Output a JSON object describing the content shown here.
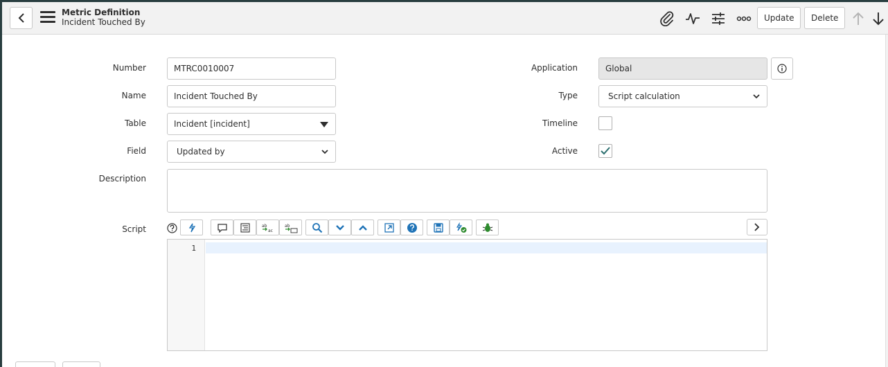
{
  "header": {
    "title": "Metric Definition",
    "subtitle": "Incident Touched By",
    "buttons": {
      "update": "Update",
      "delete": "Delete"
    },
    "icons": [
      "chevron-left-icon",
      "menu-icon",
      "paperclip-icon",
      "activity-icon",
      "sliders-icon",
      "more-icon",
      "arrow-up-icon",
      "arrow-down-icon"
    ]
  },
  "form": {
    "number": {
      "label": "Number",
      "value": "MTRC0010007"
    },
    "name": {
      "label": "Name",
      "value": "Incident Touched By"
    },
    "table": {
      "label": "Table",
      "value": "Incident [incident]"
    },
    "field": {
      "label": "Field",
      "value": "Updated by"
    },
    "description": {
      "label": "Description",
      "value": ""
    },
    "application": {
      "label": "Application",
      "value": "Global"
    },
    "type": {
      "label": "Type",
      "value": "Script calculation"
    },
    "timeline": {
      "label": "Timeline",
      "checked": false
    },
    "active": {
      "label": "Active",
      "checked": true
    },
    "script": {
      "label": "Script",
      "line_numbers": [
        "1"
      ],
      "content": ""
    }
  },
  "colors": {
    "accent": "#293e40",
    "check": "#2b6f6f",
    "toolbar_blue": "#1f73b7",
    "toolbar_green": "#2e8b2e"
  }
}
